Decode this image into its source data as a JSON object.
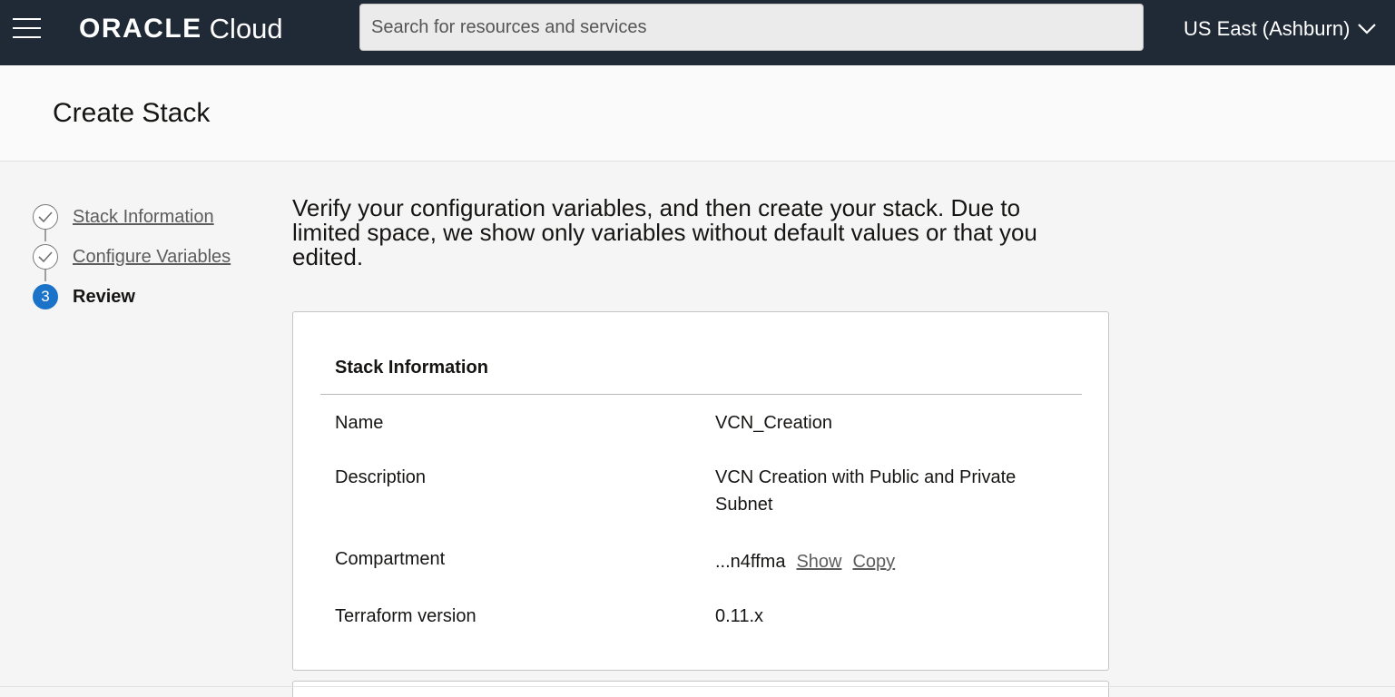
{
  "header": {
    "logo_brand": "ORACLE",
    "logo_product": "Cloud",
    "search_placeholder": "Search for resources and services",
    "region": "US East (Ashburn)"
  },
  "page": {
    "title": "Create Stack"
  },
  "steps": [
    {
      "label": "Stack Information",
      "state": "complete"
    },
    {
      "label": "Configure Variables",
      "state": "complete"
    },
    {
      "number": "3",
      "label": "Review",
      "state": "current"
    }
  ],
  "intro_text": "Verify your configuration variables, and then create your stack. Due to limited space, we show only variables without default values or that you edited.",
  "stack_info": {
    "title": "Stack Information",
    "rows": [
      {
        "label": "Name",
        "value": "VCN_Creation"
      },
      {
        "label": "Description",
        "value": "VCN Creation with Public and Private Subnet"
      },
      {
        "label": "Compartment",
        "value": "...n4ffma",
        "show_link": "Show",
        "copy_link": "Copy"
      },
      {
        "label": "Terraform version",
        "value": "0.11.x"
      }
    ]
  },
  "colors": {
    "topbar_bg": "#1f2a36",
    "active_step": "#1a73c8",
    "page_bg": "#f5f5f5"
  }
}
